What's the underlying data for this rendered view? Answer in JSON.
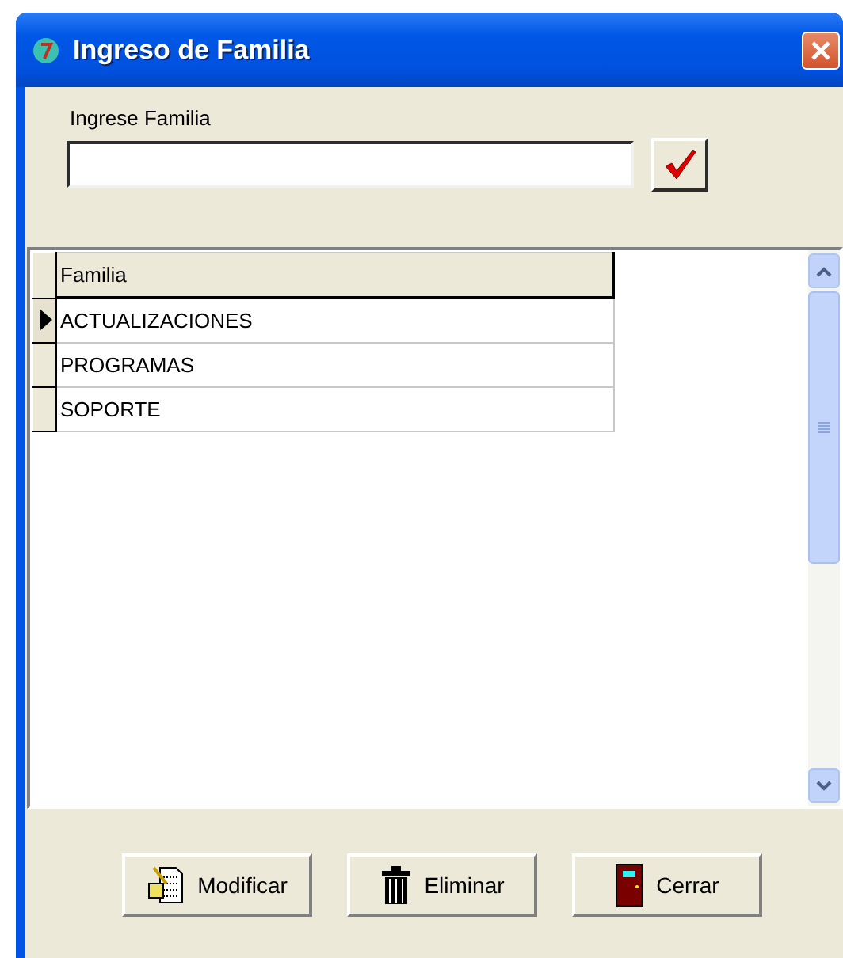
{
  "window": {
    "title": "Ingreso de Familia"
  },
  "form": {
    "label": "Ingrese Familia"
  },
  "table": {
    "columns": [
      "Familia"
    ],
    "rows": [
      {
        "cells": [
          "ACTUALIZACIONES"
        ],
        "selected": true
      },
      {
        "cells": [
          "PROGRAMAS"
        ],
        "selected": false
      },
      {
        "cells": [
          "SOPORTE"
        ],
        "selected": false
      }
    ]
  },
  "buttons": [
    {
      "kind": "edit",
      "label": "Modificar"
    },
    {
      "kind": "delete",
      "label": "Eliminar"
    },
    {
      "kind": "close",
      "label": "Cerrar"
    }
  ]
}
